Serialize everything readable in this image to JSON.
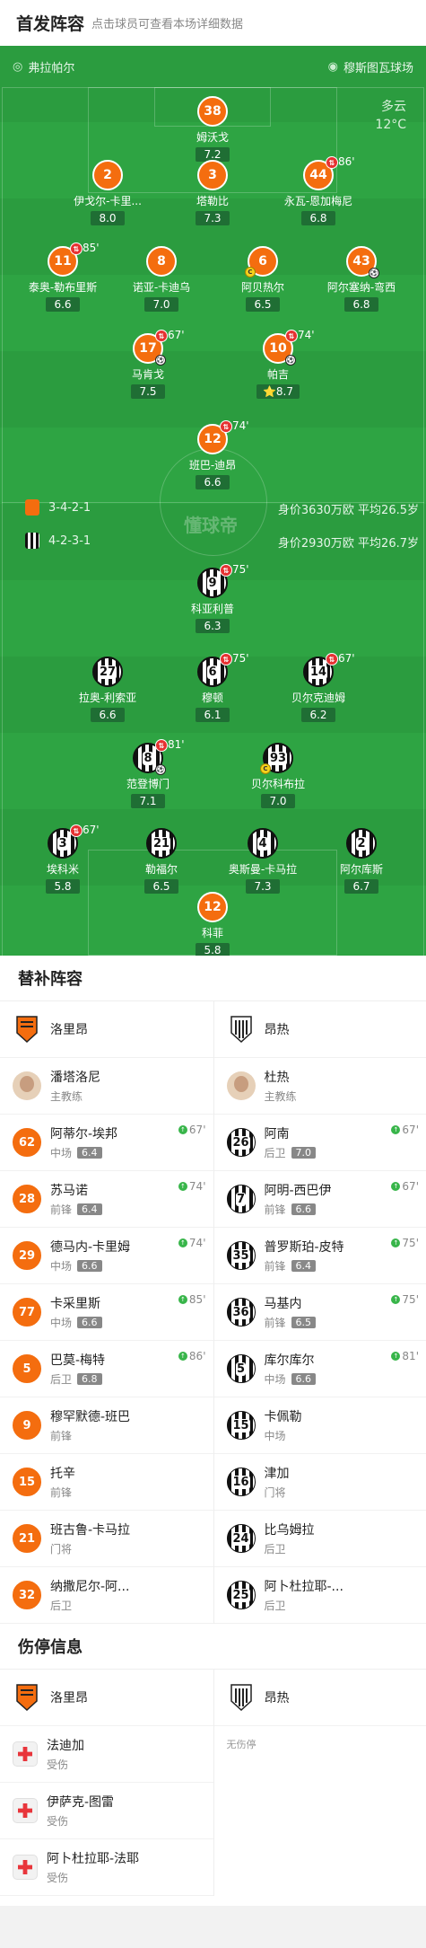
{
  "header": {
    "title": "首发阵容",
    "hint": "点击球员可查看本场详细数据"
  },
  "pitch": {
    "home_name": "弗拉帕尔",
    "venue": "穆斯图瓦球场",
    "weather": {
      "condition": "多云",
      "temp": "12°C"
    },
    "watermark": "懂球帝",
    "home_formation": "3-4-2-1",
    "home_value": "身价3630万欧 平均26.5岁",
    "away_formation": "4-2-3-1",
    "away_value": "身价2930万欧 平均26.7岁",
    "players": [
      {
        "no": "38",
        "name": "姆沃戈",
        "rating": "7.2",
        "kit": "o"
      },
      {
        "no": "2",
        "name": "伊戈尔-卡里...",
        "rating": "8.0",
        "kit": "o"
      },
      {
        "no": "3",
        "name": "塔勒比",
        "rating": "7.3",
        "kit": "o"
      },
      {
        "no": "44",
        "name": "永瓦-恩加梅尼",
        "rating": "6.8",
        "kit": "o",
        "sub": "86'"
      },
      {
        "no": "11",
        "name": "泰奥-勒布里斯",
        "rating": "6.6",
        "kit": "o",
        "sub": "85'"
      },
      {
        "no": "8",
        "name": "诺亚-卡迪乌",
        "rating": "7.0",
        "kit": "o"
      },
      {
        "no": "6",
        "name": "阿贝热尔",
        "rating": "6.5",
        "kit": "o",
        "card": true
      },
      {
        "no": "43",
        "name": "阿尔塞纳-弯西",
        "rating": "6.8",
        "kit": "o",
        "ball": true
      },
      {
        "no": "17",
        "name": "马肯戈",
        "rating": "7.5",
        "kit": "o",
        "sub": "67'",
        "ball": true
      },
      {
        "no": "10",
        "name": "帕吉",
        "rating": "8.7",
        "kit": "o",
        "sub": "74'",
        "ball": true,
        "star": true
      },
      {
        "no": "12",
        "name": "班巴-迪昂",
        "rating": "6.6",
        "kit": "o",
        "sub": "74'"
      },
      {
        "no": "9",
        "name": "科亚利普",
        "rating": "6.3",
        "kit": "w",
        "sub": "75'"
      },
      {
        "no": "27",
        "name": "拉奥-利索亚",
        "rating": "6.6",
        "kit": "w"
      },
      {
        "no": "6",
        "name": "穆顿",
        "rating": "6.1",
        "kit": "w",
        "sub": "75'"
      },
      {
        "no": "14",
        "name": "贝尔克迪姆",
        "rating": "6.2",
        "kit": "w",
        "sub": "67'"
      },
      {
        "no": "8",
        "name": "范登博门",
        "rating": "7.1",
        "kit": "w",
        "sub": "81'",
        "ball": true
      },
      {
        "no": "93",
        "name": "贝尔科布拉",
        "rating": "7.0",
        "kit": "w",
        "card": true
      },
      {
        "no": "3",
        "name": "埃科米",
        "rating": "5.8",
        "kit": "w",
        "sub": "67'"
      },
      {
        "no": "21",
        "name": "勒福尔",
        "rating": "6.5",
        "kit": "w"
      },
      {
        "no": "4",
        "name": "奥斯曼-卡马拉",
        "rating": "7.3",
        "kit": "w"
      },
      {
        "no": "2",
        "name": "阿尔库斯",
        "rating": "6.7",
        "kit": "w"
      },
      {
        "no": "12",
        "name": "科菲",
        "rating": "5.8",
        "kit": "o"
      }
    ]
  },
  "subs": {
    "title": "替补阵容",
    "home_team": "洛里昂",
    "away_team": "昂热",
    "home_coach": {
      "name": "潘塔洛尼",
      "role": "主教练"
    },
    "away_coach": {
      "name": "杜热",
      "role": "主教练"
    },
    "home": [
      {
        "no": "62",
        "name": "阿蒂尔-埃邦",
        "pos": "中场",
        "rating": "6.4",
        "time": "67'"
      },
      {
        "no": "28",
        "name": "苏马诺",
        "pos": "前锋",
        "rating": "6.4",
        "time": "74'"
      },
      {
        "no": "29",
        "name": "德马内-卡里姆",
        "pos": "中场",
        "rating": "6.6",
        "time": "74'"
      },
      {
        "no": "77",
        "name": "卡采里斯",
        "pos": "中场",
        "rating": "6.6",
        "time": "85'"
      },
      {
        "no": "5",
        "name": "巴莫-梅特",
        "pos": "后卫",
        "rating": "6.8",
        "time": "86'"
      },
      {
        "no": "9",
        "name": "穆罕默德-班巴",
        "pos": "前锋"
      },
      {
        "no": "15",
        "name": "托辛",
        "pos": "前锋"
      },
      {
        "no": "21",
        "name": "班古鲁-卡马拉",
        "pos": "门将"
      },
      {
        "no": "32",
        "name": "纳撒尼尔-阿...",
        "pos": "后卫"
      }
    ],
    "away": [
      {
        "no": "26",
        "name": "阿南",
        "pos": "后卫",
        "rating": "7.0",
        "time": "67'"
      },
      {
        "no": "7",
        "name": "阿明-西巴伊",
        "pos": "前锋",
        "rating": "6.6",
        "time": "67'"
      },
      {
        "no": "35",
        "name": "普罗斯珀-皮特",
        "pos": "前锋",
        "rating": "6.4",
        "time": "75'"
      },
      {
        "no": "36",
        "name": "马基内",
        "pos": "前锋",
        "rating": "6.5",
        "time": "75'"
      },
      {
        "no": "5",
        "name": "库尔库尔",
        "pos": "中场",
        "rating": "6.6",
        "time": "81'"
      },
      {
        "no": "15",
        "name": "卡佩勒",
        "pos": "中场"
      },
      {
        "no": "16",
        "name": "津加",
        "pos": "门将"
      },
      {
        "no": "24",
        "name": "比乌姆拉",
        "pos": "后卫"
      },
      {
        "no": "25",
        "name": "阿卜杜拉耶-...",
        "pos": "后卫"
      }
    ]
  },
  "injuries": {
    "title": "伤停信息",
    "home_team": "洛里昂",
    "away_team": "昂热",
    "home": [
      {
        "name": "法迪加",
        "status": "受伤"
      },
      {
        "name": "伊萨克-图雷",
        "status": "受伤"
      },
      {
        "name": "阿卜杜拉耶-法耶",
        "status": "受伤"
      }
    ],
    "away_empty": "无伤停"
  },
  "colors": {
    "pitch": "#2ea443",
    "home_kit": "#f46d0f",
    "rating_bg": "#1f6e34",
    "up_arrow": "#38b54a"
  }
}
